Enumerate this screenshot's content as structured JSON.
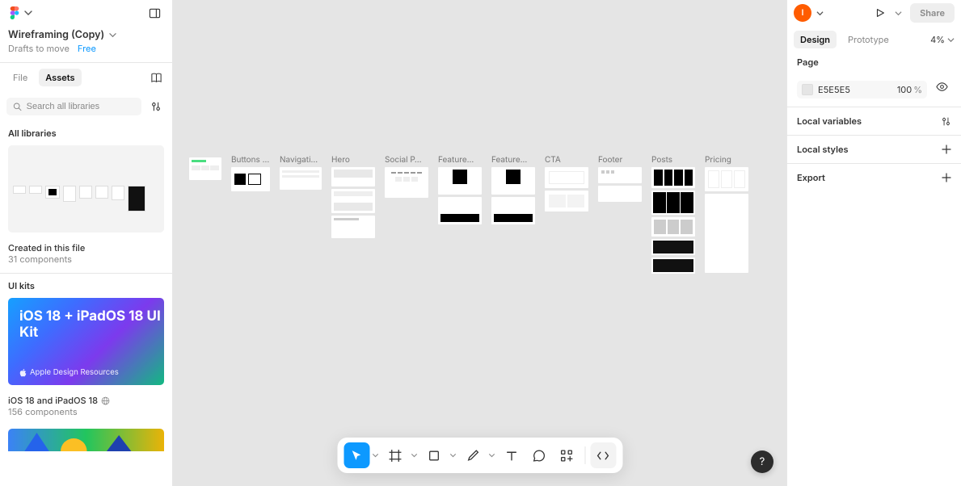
{
  "header": {
    "file_title": "Wireframing (Copy)",
    "location": "Drafts to move",
    "plan": "Free"
  },
  "left_tabs": {
    "file": "File",
    "assets": "Assets"
  },
  "search": {
    "placeholder": "Search all libraries"
  },
  "sections": {
    "all_libraries": "All libraries",
    "created_title": "Created in this file",
    "created_count": "31 components",
    "ui_kits": "UI kits",
    "ios_card_title": "iOS 18 + iPadOS 18 UI Kit",
    "ios_card_footer": "Apple Design Resources",
    "ios_row_title": "iOS 18 and iPadOS 18",
    "ios_row_count": "156 components"
  },
  "canvas_frames": [
    {
      "label": "",
      "w": 40,
      "h": 28
    },
    {
      "label": "Buttons …",
      "w": 48,
      "h": 30
    },
    {
      "label": "Navigati…",
      "w": 52,
      "h": 28
    },
    {
      "label": "Hero",
      "w": 54,
      "h": 90
    },
    {
      "label": "Social P…",
      "w": 54,
      "h": 38
    },
    {
      "label": "Feature…",
      "w": 54,
      "h": 72
    },
    {
      "label": "Feature…",
      "w": 54,
      "h": 72
    },
    {
      "label": "CTA",
      "w": 54,
      "h": 56
    },
    {
      "label": "Footer",
      "w": 54,
      "h": 44
    },
    {
      "label": "Posts",
      "w": 54,
      "h": 132
    },
    {
      "label": "Pricing",
      "w": 54,
      "h": 132
    }
  ],
  "right": {
    "avatar": "I",
    "share": "Share",
    "tabs": {
      "design": "Design",
      "prototype": "Prototype"
    },
    "zoom": "4%",
    "page_head": "Page",
    "page_hex": "E5E5E5",
    "page_opacity": "100",
    "page_opacity_unit": "%",
    "local_vars": "Local variables",
    "local_styles": "Local styles",
    "export": "Export"
  },
  "help": "?"
}
